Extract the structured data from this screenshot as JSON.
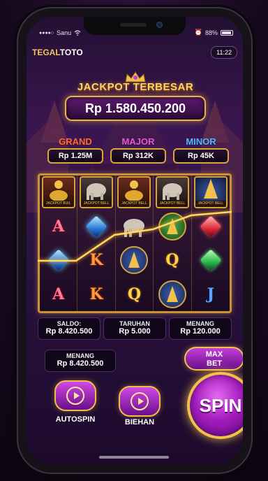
{
  "status_bar": {
    "carrier": "Sanu",
    "time": "11:22 AM",
    "battery": "88%"
  },
  "header": {
    "brand_part1": "TEGAL",
    "brand_part2": "TOTO",
    "clock": "11:22"
  },
  "jackpot": {
    "title": "JACKPOT TERBESAR",
    "amount": "Rp 1.580.450.200"
  },
  "tiers": [
    {
      "label": "GRAND",
      "value": "Rp 1.25M"
    },
    {
      "label": "MAJOR",
      "value": "Rp 312K"
    },
    {
      "label": "MINOR",
      "value": "Rp 45K"
    }
  ],
  "reels": {
    "card_captions": [
      "JACKPOT BUIL",
      "JACKPOT BELL",
      "JACKPOT BELL",
      "JACKPOT BELL",
      "JACKPOT BELL"
    ],
    "rows": [
      [
        "buddha-card",
        "elephant-card",
        "buddha-card",
        "elephant-card",
        "stupa-circle"
      ],
      [
        "A",
        "blue-gem",
        "elephant",
        "stupa-green",
        "red-gem"
      ],
      [
        "blue-gem",
        "K",
        "stupa-blue",
        "Q",
        "green-gem"
      ],
      [
        "A",
        "K",
        "Q",
        "stupa-blue",
        "J"
      ]
    ]
  },
  "stats": {
    "saldo_label": "SALDO:",
    "saldo_value": "Rp 8.420.500",
    "taruhan_label": "TARUHAN",
    "taruhan_value": "Rp 5.000",
    "menang_label": "MENANG",
    "menang_value": "Rp 120.000",
    "menang2_label": "MENANG",
    "menang2_value": "Rp 8.420.500"
  },
  "buttons": {
    "maxbet_line1": "MAX",
    "maxbet_line2": "BET",
    "autospin": "AUTOSPIN",
    "bet": "BIEHAN",
    "spin": "SPIN"
  },
  "colors": {
    "gold": "#e7b449",
    "purple": "#a51dbf",
    "grand": "#ff6a3a",
    "major": "#e25ad8",
    "minor": "#5ab2ff"
  }
}
